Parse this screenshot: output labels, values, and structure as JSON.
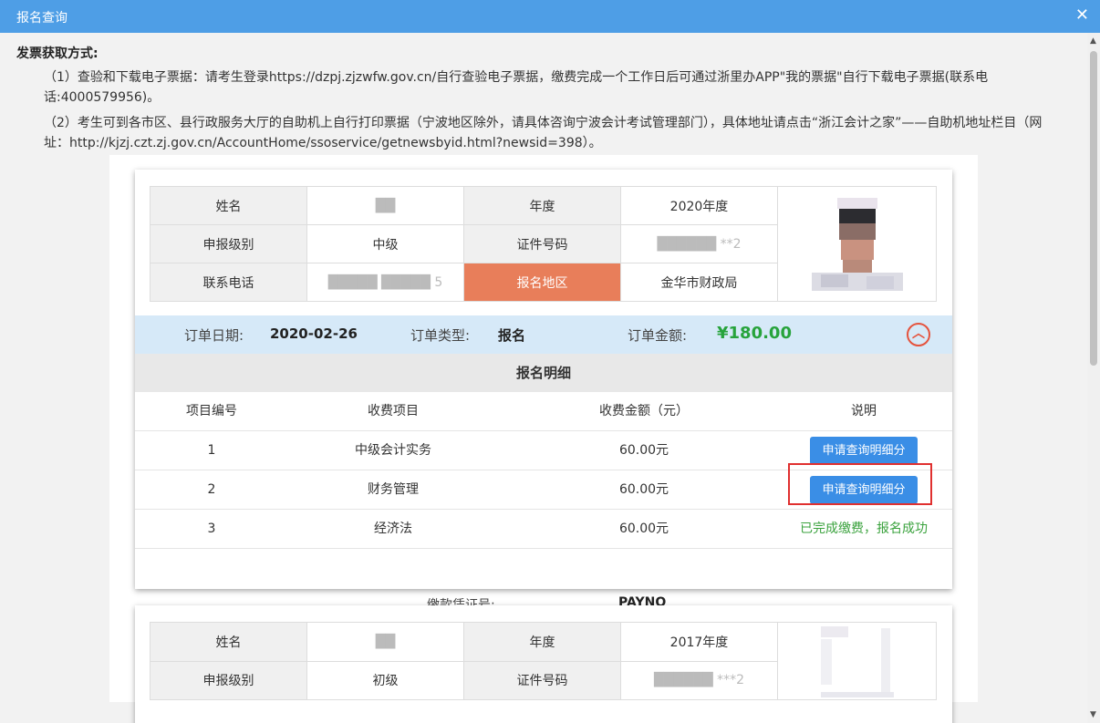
{
  "window": {
    "title": "报名查询"
  },
  "invoice": {
    "heading": "发票获取方式:",
    "line1": "（1）查验和下载电子票据：请考生登录https://dzpj.zjzwfw.gov.cn/自行查验电子票据，缴费完成一个工作日后可通过浙里办APP\"我的票据\"自行下载电子票据(联系电话:4000579956)。",
    "line2": "（2）考生可到各市区、县行政服务大厅的自助机上自行打印票据（宁波地区除外，请具体咨询宁波会计考试管理部门），具体地址请点击“浙江会计之家”——自助机地址栏目（网址：http://kjzj.czt.zj.gov.cn/AccountHome/ssoservice/getnewsbyid.html?newsid=398）。"
  },
  "labels": {
    "name": "姓名",
    "year": "年度",
    "level": "申报级别",
    "id_number": "证件号码",
    "phone": "联系电话",
    "region": "报名地区",
    "order_date": "订单日期:",
    "order_type": "订单类型:",
    "order_amount": "订单金额:",
    "detail_title": "报名明细",
    "col_no": "项目编号",
    "col_item": "收费项目",
    "col_fee": "收费金额（元）",
    "col_note": "说明",
    "payno_label": "缴款凭证号:"
  },
  "record1": {
    "name": "██",
    "year": "2020年度",
    "level": "中级",
    "id_number": "██████ **2",
    "phone": "█████ █████ 5",
    "region": "金华市财政局",
    "order_date": "2020-02-26",
    "order_type": "报名",
    "order_amount": "¥180.00",
    "items": [
      {
        "no": "1",
        "item": "中级会计实务",
        "fee": "60.00元",
        "action": "申请查询明细分"
      },
      {
        "no": "2",
        "item": "财务管理",
        "fee": "60.00元",
        "action": "申请查询明细分"
      },
      {
        "no": "3",
        "item": "经济法",
        "fee": "60.00元",
        "status": "已完成缴费，报名成功"
      }
    ],
    "payno": "PAYNO"
  },
  "record2": {
    "name": "██",
    "year": "2017年度",
    "level": "初级",
    "id_number": "██████ ***2"
  },
  "colors": {
    "titlebar": "#4e9ee6",
    "region_cell": "#e87e5a",
    "order_bar": "#d6e9f8",
    "amount": "#27a33c",
    "button": "#3a8ee6",
    "highlight": "#e0302f",
    "success": "#3aa23d"
  }
}
